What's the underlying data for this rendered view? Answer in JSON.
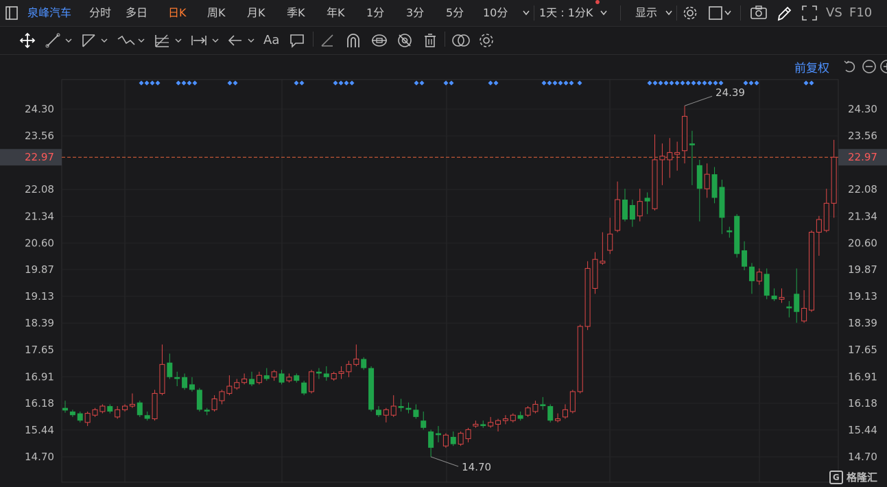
{
  "topbar": {
    "stock_name": "泉峰汽车",
    "periods": [
      "分时",
      "多日",
      "日K",
      "周K",
      "月K",
      "季K",
      "年K",
      "1分",
      "3分",
      "5分",
      "10分"
    ],
    "active_period": "日K",
    "interval_label": "1天 : 1分K",
    "display_label": "显示",
    "vs_label": "VS",
    "f10_label": "F10"
  },
  "toolbar": {
    "tools": [
      "move-icon",
      "line-icon",
      "channel-icon",
      "wave-icon",
      "fib-icon",
      "measure-icon",
      "arrow-icon",
      "text-icon",
      "comment-icon",
      "eraser-icon",
      "magnet-icon",
      "lock-icon",
      "hide-icon",
      "delete-icon",
      "compare-icon",
      "settings-icon"
    ],
    "text_tool_label": "Aa"
  },
  "adjust_label": "前复权",
  "colors": {
    "up": "#e04848",
    "down": "#1fa34a",
    "accent": "#ff7a2f",
    "price_line": "#e8643c",
    "marker": "#4d90fe"
  },
  "chart_data": {
    "type": "candlestick",
    "yticks": [
      "24.30",
      "23.56",
      "22.08",
      "21.34",
      "20.60",
      "19.87",
      "19.13",
      "18.39",
      "17.65",
      "16.91",
      "16.18",
      "15.44",
      "14.70"
    ],
    "ylim": [
      14.45,
      25.05
    ],
    "current_price": "22.97",
    "max_label": "24.39",
    "min_label": "14.70",
    "candles": [
      [
        16.05,
        15.98,
        16.25,
        15.92
      ],
      [
        15.95,
        15.85,
        16.0,
        15.8
      ],
      [
        15.9,
        15.7,
        15.95,
        15.65
      ],
      [
        15.65,
        15.9,
        15.95,
        15.55
      ],
      [
        15.85,
        16.0,
        16.05,
        15.8
      ],
      [
        15.95,
        16.1,
        16.15,
        15.9
      ],
      [
        16.1,
        15.95,
        16.15,
        15.9
      ],
      [
        15.8,
        16.0,
        16.1,
        15.75
      ],
      [
        16.0,
        16.1,
        16.15,
        15.95
      ],
      [
        16.1,
        16.15,
        16.45,
        16.05
      ],
      [
        16.2,
        15.85,
        16.25,
        15.8
      ],
      [
        15.85,
        15.75,
        15.95,
        15.7
      ],
      [
        15.75,
        16.45,
        16.55,
        15.7
      ],
      [
        16.45,
        17.25,
        17.8,
        16.4
      ],
      [
        17.3,
        16.9,
        17.55,
        16.85
      ],
      [
        16.9,
        16.85,
        17.05,
        16.65
      ],
      [
        16.9,
        16.6,
        17.0,
        16.55
      ],
      [
        16.7,
        16.55,
        16.9,
        16.5
      ],
      [
        16.55,
        16.0,
        16.6,
        15.95
      ],
      [
        16.0,
        15.95,
        16.05,
        15.85
      ],
      [
        16.0,
        16.3,
        16.4,
        15.95
      ],
      [
        16.25,
        16.5,
        16.55,
        16.15
      ],
      [
        16.45,
        16.65,
        16.95,
        16.4
      ],
      [
        16.6,
        16.75,
        16.85,
        16.55
      ],
      [
        16.75,
        16.85,
        17.0,
        16.7
      ],
      [
        16.85,
        16.7,
        17.05,
        16.65
      ],
      [
        16.75,
        16.95,
        17.05,
        16.7
      ],
      [
        16.95,
        16.85,
        17.15,
        16.8
      ],
      [
        16.9,
        17.05,
        17.1,
        16.8
      ],
      [
        17.0,
        16.75,
        17.1,
        16.7
      ],
      [
        16.8,
        16.9,
        17.0,
        16.75
      ],
      [
        16.95,
        16.8,
        17.0,
        16.75
      ],
      [
        16.75,
        16.45,
        16.8,
        16.4
      ],
      [
        16.5,
        17.05,
        17.1,
        16.45
      ],
      [
        17.05,
        17.0,
        17.15,
        16.85
      ],
      [
        17.0,
        16.9,
        17.2,
        16.8
      ],
      [
        16.85,
        17.0,
        17.05,
        16.8
      ],
      [
        17.0,
        17.05,
        17.2,
        16.85
      ],
      [
        17.05,
        17.25,
        17.35,
        16.9
      ],
      [
        17.25,
        17.4,
        17.8,
        17.2
      ],
      [
        17.4,
        17.15,
        17.45,
        17.1
      ],
      [
        17.15,
        16.0,
        17.2,
        15.95
      ],
      [
        16.0,
        15.85,
        16.1,
        15.8
      ],
      [
        15.85,
        16.0,
        16.05,
        15.65
      ],
      [
        15.85,
        16.1,
        16.4,
        15.8
      ],
      [
        16.1,
        16.05,
        16.3,
        15.95
      ],
      [
        16.05,
        16.0,
        16.2,
        15.9
      ],
      [
        16.0,
        15.8,
        16.15,
        15.75
      ],
      [
        15.7,
        15.5,
        15.95,
        15.45
      ],
      [
        15.4,
        14.95,
        15.45,
        14.7
      ],
      [
        15.35,
        15.3,
        15.55,
        15.1
      ],
      [
        15.0,
        15.3,
        15.35,
        14.95
      ],
      [
        15.25,
        15.05,
        15.4,
        15.0
      ],
      [
        15.05,
        15.35,
        15.4,
        15.0
      ],
      [
        15.2,
        15.45,
        15.5,
        15.1
      ],
      [
        15.55,
        15.6,
        15.7,
        15.5
      ],
      [
        15.6,
        15.55,
        15.7,
        15.5
      ],
      [
        15.55,
        15.65,
        15.8,
        15.5
      ],
      [
        15.6,
        15.7,
        15.75,
        15.4
      ],
      [
        15.7,
        15.75,
        15.85,
        15.6
      ],
      [
        15.7,
        15.85,
        15.9,
        15.65
      ],
      [
        15.85,
        15.75,
        15.95,
        15.7
      ],
      [
        15.85,
        16.05,
        16.1,
        15.8
      ],
      [
        15.95,
        16.15,
        16.25,
        15.9
      ],
      [
        16.15,
        16.1,
        16.35,
        16.0
      ],
      [
        16.1,
        15.7,
        16.15,
        15.65
      ],
      [
        15.7,
        15.75,
        15.9,
        15.65
      ],
      [
        15.8,
        16.0,
        16.15,
        15.75
      ],
      [
        15.95,
        16.5,
        16.55,
        15.9
      ],
      [
        16.5,
        18.3,
        18.35,
        16.45
      ],
      [
        18.3,
        19.9,
        20.1,
        18.2
      ],
      [
        19.35,
        20.15,
        20.35,
        19.2
      ],
      [
        20.05,
        20.1,
        20.9,
        20.0
      ],
      [
        20.4,
        20.85,
        21.3,
        20.3
      ],
      [
        20.95,
        21.8,
        22.3,
        20.9
      ],
      [
        21.8,
        21.25,
        22.1,
        21.2
      ],
      [
        21.65,
        21.25,
        21.8,
        21.05
      ],
      [
        21.35,
        21.75,
        22.1,
        21.2
      ],
      [
        21.85,
        21.75,
        22.0,
        21.4
      ],
      [
        21.55,
        22.9,
        23.6,
        21.5
      ],
      [
        22.9,
        23.0,
        23.35,
        22.2
      ],
      [
        22.9,
        23.1,
        23.5,
        22.4
      ],
      [
        23.05,
        23.1,
        23.4,
        22.6
      ],
      [
        23.15,
        24.1,
        24.39,
        22.8
      ],
      [
        23.35,
        23.3,
        23.7,
        22.2
      ],
      [
        22.75,
        22.1,
        22.9,
        21.2
      ],
      [
        22.1,
        22.5,
        22.8,
        21.85
      ],
      [
        22.5,
        21.85,
        22.7,
        21.7
      ],
      [
        22.15,
        21.3,
        22.35,
        20.85
      ],
      [
        20.95,
        20.9,
        21.05,
        20.75
      ],
      [
        21.35,
        20.3,
        21.4,
        20.2
      ],
      [
        20.4,
        19.95,
        20.65,
        19.85
      ],
      [
        19.95,
        19.55,
        20.05,
        19.2
      ],
      [
        19.55,
        19.8,
        19.9,
        19.45
      ],
      [
        19.75,
        19.15,
        19.9,
        19.05
      ],
      [
        19.15,
        19.05,
        19.35,
        19.0
      ],
      [
        19.05,
        19.1,
        19.35,
        18.95
      ],
      [
        18.85,
        18.8,
        19.0,
        18.55
      ],
      [
        19.2,
        18.7,
        19.9,
        18.4
      ],
      [
        18.45,
        18.8,
        19.3,
        18.4
      ],
      [
        18.75,
        20.9,
        20.95,
        18.7
      ],
      [
        20.9,
        21.25,
        21.35,
        20.25
      ],
      [
        20.95,
        21.7,
        22.1,
        20.9
      ],
      [
        21.7,
        22.97,
        23.45,
        21.3
      ]
    ],
    "markers_x": [
      206,
      214,
      222,
      230,
      260,
      268,
      276,
      284,
      335,
      343,
      432,
      440,
      489,
      497,
      505,
      513,
      607,
      615,
      650,
      658,
      715,
      723,
      793,
      801,
      809,
      817,
      825,
      833,
      845,
      947,
      955,
      963,
      971,
      979,
      987,
      995,
      1003,
      1011,
      1019,
      1027,
      1035,
      1043,
      1051,
      1087,
      1095,
      1103,
      1175,
      1183
    ]
  }
}
